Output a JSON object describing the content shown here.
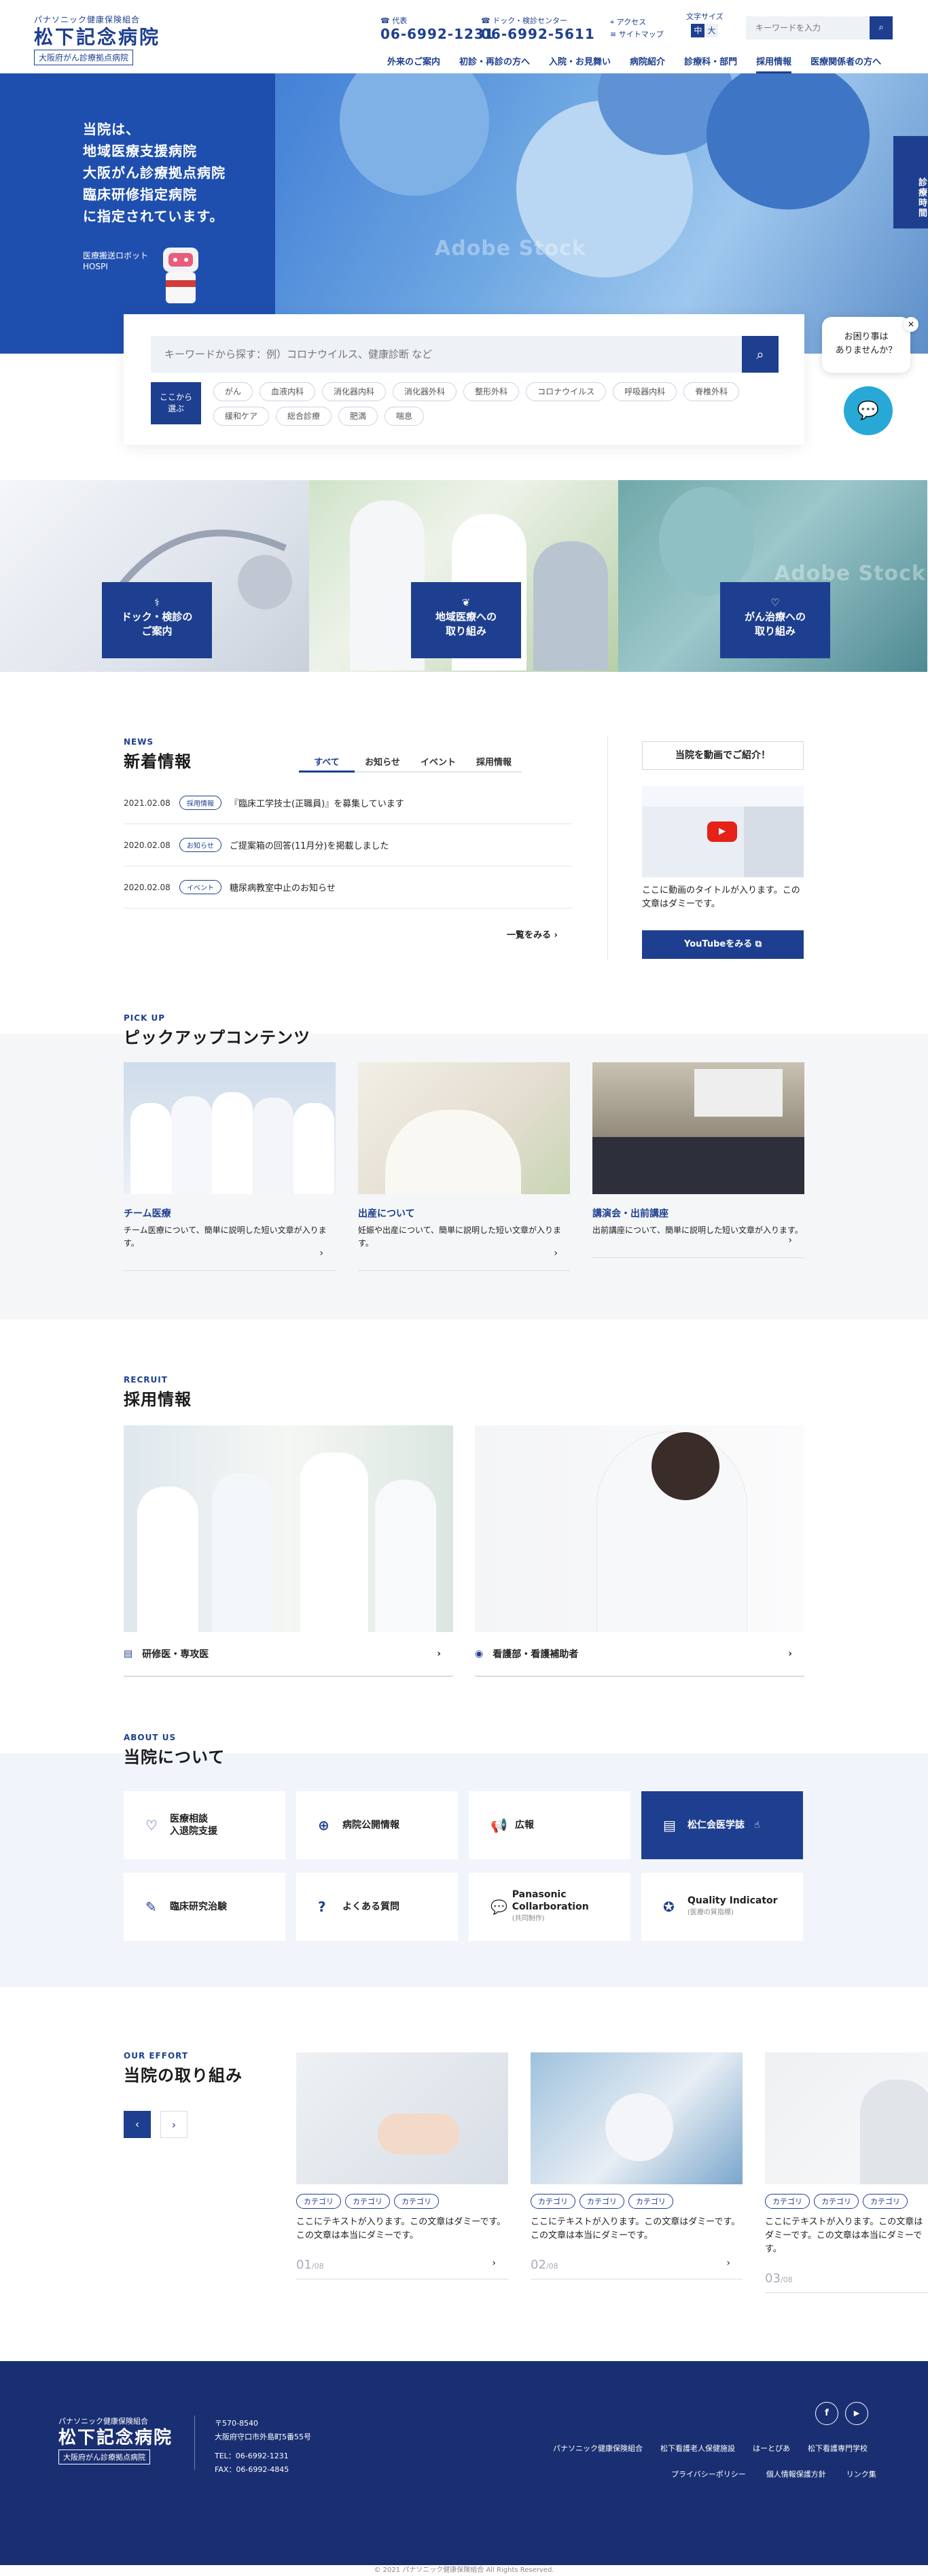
{
  "header": {
    "logo_sub": "パナソニック健康保険組合",
    "logo_main": "松下記念病院",
    "logo_box": "大阪府がん診療拠点病院",
    "main_phone_label": "代表",
    "main_phone": "06-6992-1231",
    "dock_phone_label": "ドック・検診センター",
    "dock_phone": "06-6992-5611",
    "access": "アクセス",
    "sitemap": "サイトマップ",
    "font_size_label": "文字サイズ",
    "font_sizes": [
      "中",
      "大"
    ],
    "search_placeholder": "キーワードを入力",
    "nav": [
      "外来のご案内",
      "初診・再診の方へ",
      "入院・お見舞い",
      "病院紹介",
      "診療科・部門",
      "採用情報",
      "医療関係者の方へ"
    ]
  },
  "hero": {
    "lines": [
      "当院は、",
      "地域医療支援病院",
      "大阪がん診療拠点病院",
      "臨床研修指定病院",
      "に指定されています。"
    ],
    "robot_label": "医療搬送ロボット",
    "robot_name": "HOSPI",
    "side_tab": "診療時間",
    "watermark": "Adobe Stock"
  },
  "search": {
    "placeholder": "キーワードから探す：例）コロナウイルス、健康診断 など",
    "keyword_label_1": "ここから",
    "keyword_label_2": "選ぶ",
    "tags": [
      "がん",
      "血液内科",
      "消化器内科",
      "消化器外科",
      "整形外科",
      "コロナウイルス",
      "呼吸器内科",
      "脊椎外科",
      "緩和ケア",
      "総合診療",
      "肥満",
      "喘息"
    ]
  },
  "help": {
    "line1": "お困り事は",
    "line2": "ありませんか？"
  },
  "banners": [
    {
      "line1": "ドック・検診の",
      "line2": "ご案内"
    },
    {
      "line1": "地域医療への",
      "line2": "取り組み"
    },
    {
      "line1": "がん治療への",
      "line2": "取り組み"
    }
  ],
  "news": {
    "tag": "NEWS",
    "title": "新着情報",
    "tabs": [
      "すべて",
      "お知らせ",
      "イベント",
      "採用情報"
    ],
    "items": [
      {
        "date": "2021.02.08",
        "category": "採用情報",
        "title": "『臨床工学技士(正職員)』を募集しています"
      },
      {
        "date": "2020.02.08",
        "category": "お知らせ",
        "title": "ご提案箱の回答(11月分)を掲載しました"
      },
      {
        "date": "2020.02.08",
        "category": "イベント",
        "title": "糖尿病教室中止のお知らせ"
      }
    ],
    "more": "一覧をみる"
  },
  "video": {
    "heading": "当院を動画でご紹介！",
    "text": "ここに動画のタイトルが入ります。この文章はダミーです。",
    "button": "YouTubeをみる"
  },
  "pickup": {
    "tag": "PICK UP",
    "title": "ピックアップコンテンツ",
    "cards": [
      {
        "title": "チーム医療",
        "text": "チーム医療について、簡単に説明した短い文章が入ります。"
      },
      {
        "title": "出産について",
        "text": "妊娠や出産について、簡単に説明した短い文章が入ります。"
      },
      {
        "title": "講演会・出前講座",
        "text": "出前講座について、簡単に説明した短い文章が入ります。"
      }
    ]
  },
  "recruit": {
    "tag": "RECRUIT",
    "title": "採用情報",
    "cards": [
      {
        "label": "研修医・専攻医"
      },
      {
        "label": "看護部・看護補助者"
      }
    ]
  },
  "about": {
    "tag": "ABOUT US",
    "title": "当院について",
    "items": [
      {
        "label": "医療相談\n入退院支援",
        "icon": "heart-hand-icon"
      },
      {
        "label": "病院公開情報",
        "icon": "globe-icon"
      },
      {
        "label": "広報",
        "icon": "megaphone-icon"
      },
      {
        "label": "松仁会医学誌",
        "icon": "book-icon"
      },
      {
        "label": "臨床研究治験",
        "icon": "pen-icon"
      },
      {
        "label": "よくある質問",
        "icon": "question-icon"
      },
      {
        "label": "Panasonic Collarboration",
        "sub": "(共同制作)",
        "icon": "chat-icon"
      },
      {
        "label": "Quality Indicator",
        "sub": "(医療の質指標)",
        "icon": "medal-icon"
      }
    ]
  },
  "effort": {
    "tag": "OUR EFFORT",
    "title": "当院の取り組み",
    "category": "カテゴリ",
    "cards": [
      {
        "text": "ここにテキストが入ります。この文章はダミーです。この文章は本当にダミーです。",
        "num": "01",
        "total": "/08"
      },
      {
        "text": "ここにテキストが入ります。この文章はダミーです。この文章は本当にダミーです。",
        "num": "02",
        "total": "/08"
      },
      {
        "text": "ここにテキストが入ります。この文章はダミーです。この文章は本当にダミーです。",
        "num": "03",
        "total": "/08"
      }
    ]
  },
  "footer": {
    "logo_sub": "パナソニック健康保険組合",
    "logo_main": "松下記念病院",
    "logo_box": "大阪府がん診療拠点病院",
    "postal": "〒570-8540",
    "address": "大阪府守口市外島町5番55号",
    "tel": "TEL：06-6992-1231",
    "fax": "FAX：06-6992-4845",
    "links1": [
      "パナソニック健康保険組合",
      "松下看護老人保健施設",
      "はーとぴあ",
      "松下看護専門学校"
    ],
    "links2": [
      "プライバシーポリシー",
      "個人情報保護方針",
      "リンク集"
    ],
    "copyright": "© 2021 パナソニック健康保険組合 All Rights Reserved."
  },
  "colors": {
    "primary": "#1e3f8f",
    "footer": "#1a2f72",
    "chat": "#27a8d6"
  }
}
